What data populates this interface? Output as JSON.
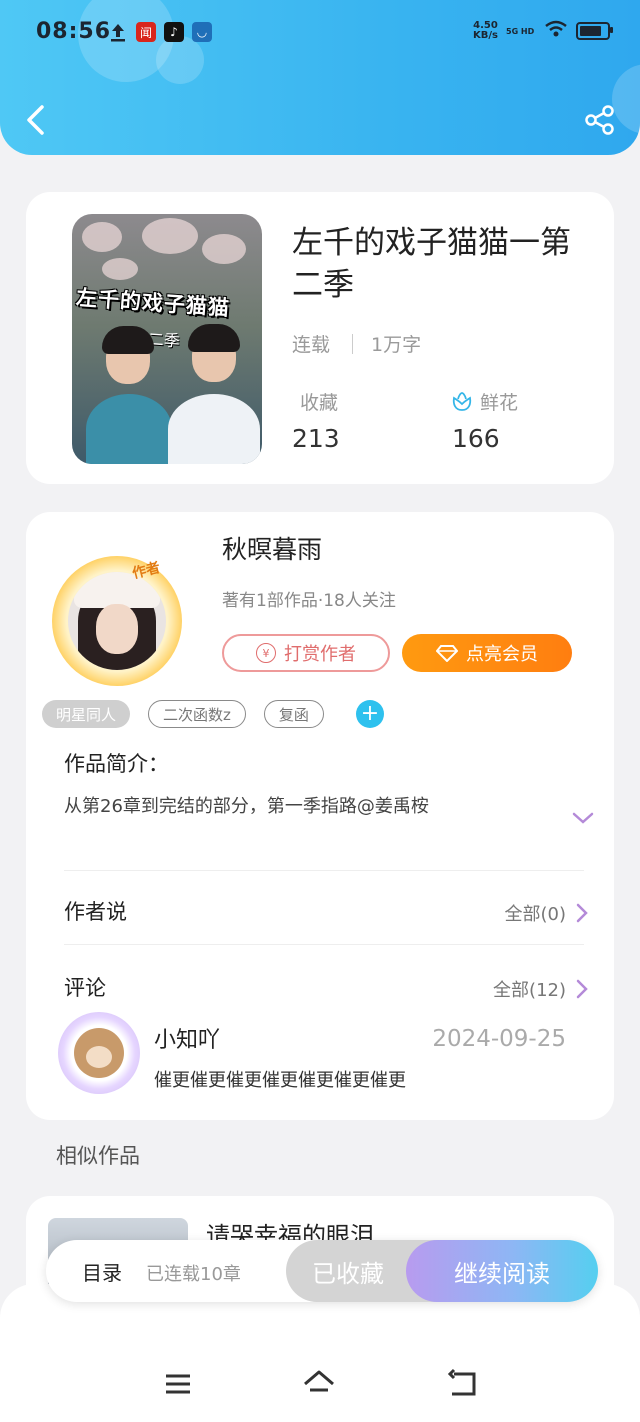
{
  "status_bar": {
    "time": "08:56",
    "speed_value": "4.50",
    "speed_unit": "KB/s",
    "network": "5G HD",
    "icons": [
      "upload-icon",
      "news-app-icon",
      "tiktok-icon",
      "message-app-icon",
      "wifi-icon",
      "battery-icon"
    ]
  },
  "header": {
    "back_icon": "chevron-left-icon",
    "share_icon": "share-icon",
    "gradient": [
      "#4fc8f5",
      "#2fa8ee"
    ]
  },
  "book": {
    "title": "左千的戏子猫猫一第二季",
    "cover_title": "左千的戏子猫猫",
    "cover_subtitle": "第二季",
    "status": "连载",
    "word_count": "1万字",
    "favorites_label": "收藏",
    "favorites_count": "213",
    "flowers_label": "鲜花",
    "flowers_count": "166"
  },
  "author": {
    "badge": "作者",
    "name": "秋暝暮雨",
    "info": "著有1部作品·18人关注",
    "tip_button": "打赏作者",
    "vip_button": "点亮会员",
    "tags": [
      "明星同人",
      "二次函数z",
      "复函"
    ]
  },
  "intro": {
    "title": "作品简介：",
    "text": "从第26章到完结的部分，第一季指路@姜禹桉"
  },
  "author_says": {
    "title": "作者说",
    "more": "全部(0)"
  },
  "comments": {
    "title": "评论",
    "more": "全部(12)",
    "items": [
      {
        "user": "小知吖",
        "date": "2024-09-25",
        "text": "催更催更催更催更催更催更催更"
      }
    ]
  },
  "similar": {
    "heading": "相似作品",
    "items": [
      {
        "title": "请哭幸福的眼泪"
      }
    ]
  },
  "action_bar": {
    "toc": "目录",
    "chapters": "已连载10章",
    "favorited": "已收藏",
    "continue": "继续阅读"
  },
  "colors": {
    "accent_blue": "#2ec1ee",
    "vip_orange": "#ff8a10",
    "tip_red": "#e06d6d"
  }
}
